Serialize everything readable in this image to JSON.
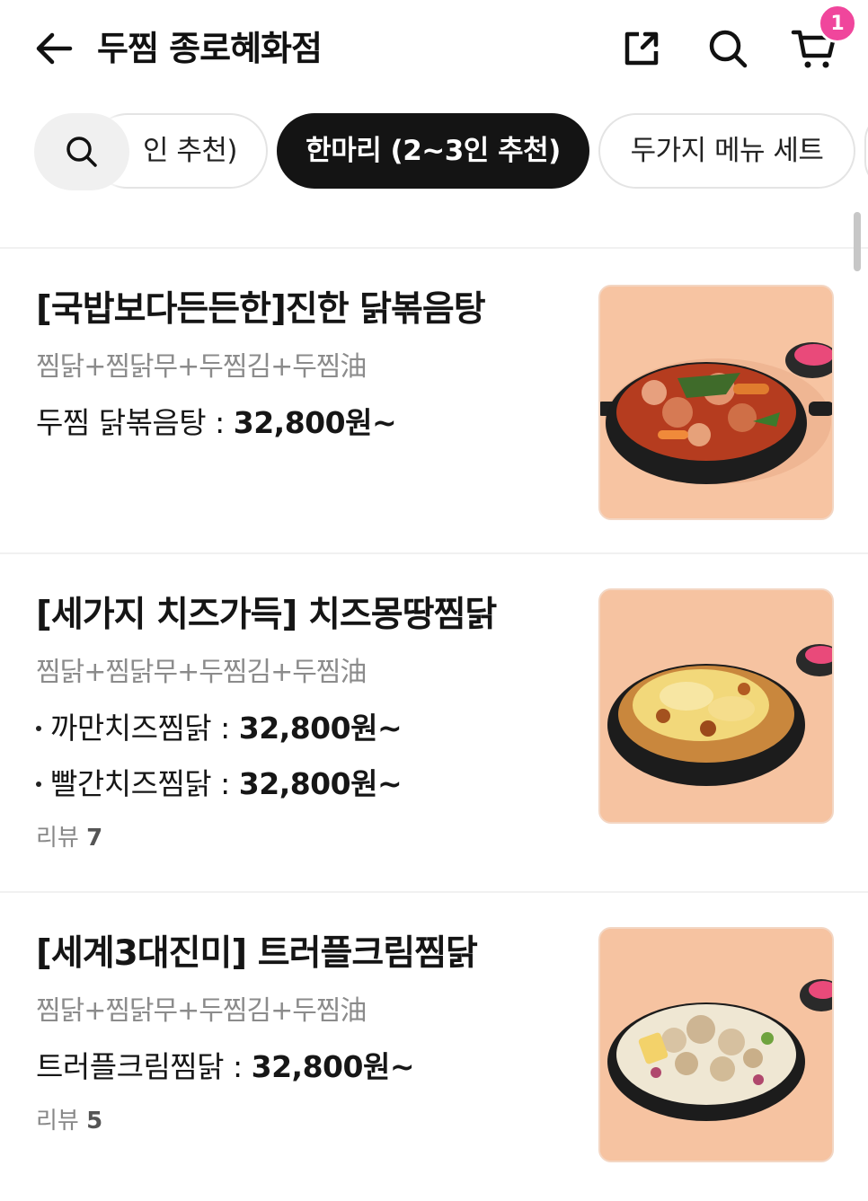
{
  "header": {
    "title": "두찜 종로혜화점",
    "cart_count": "1",
    "icons": [
      "back-arrow-icon",
      "share-icon",
      "search-icon",
      "cart-icon"
    ]
  },
  "categories": {
    "items": [
      "인 추천)",
      "한마리 (2~3인 추천)",
      "두가지 메뉴 세트",
      ""
    ],
    "selected_index": 1
  },
  "menu": {
    "items": [
      {
        "title": "[국밥보다든든한]진한 닭볶음탕",
        "desc": "찜닭+찜닭무+두찜김+두찜油",
        "prices": [
          {
            "name": "두찜 닭볶음탕 : ",
            "price": "32,800원~"
          }
        ]
      },
      {
        "title": "[세가지 치즈가득] 치즈몽땅찜닭",
        "desc": "찜닭+찜닭무+두찜김+두찜油",
        "prices": [
          {
            "name": "까만치즈찜닭 : ",
            "price": "32,800원~"
          },
          {
            "name": "빨간치즈찜닭 : ",
            "price": "32,800원~"
          }
        ],
        "review_label": "리뷰",
        "review_count": "7"
      },
      {
        "title": "[세계3대진미] 트러플크림찜닭",
        "desc": "찜닭+찜닭무+두찜김+두찜油",
        "prices": [
          {
            "name": "트러플크림찜닭 : ",
            "price": "32,800원~"
          }
        ],
        "review_label": "리뷰",
        "review_count": "5"
      }
    ]
  },
  "colors": {
    "accent_badge": "#f0469c",
    "selected_chip": "#141414",
    "muted_text": "#8b8b8b",
    "thumb_bg": "#f6c3a3"
  }
}
